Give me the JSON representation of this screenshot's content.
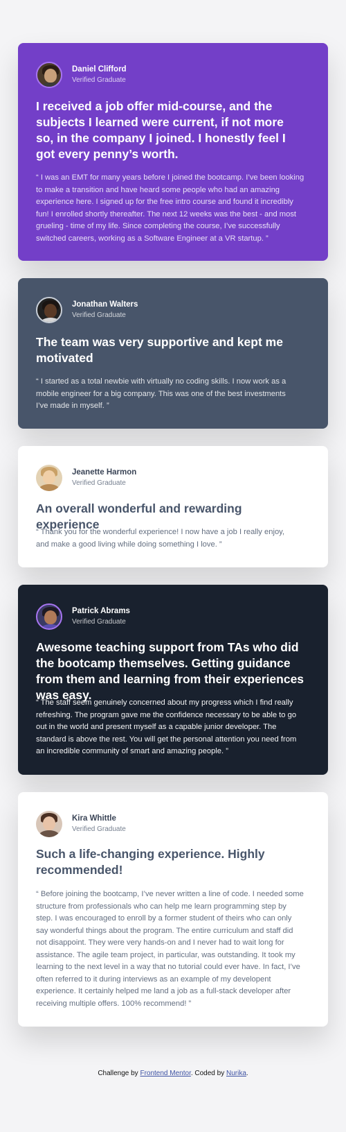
{
  "testimonials": [
    {
      "name": "Daniel Clifford",
      "status": "Verified Graduate",
      "headline": "I received a job offer mid-course, and the subjects I learned were current, if not more so, in the company I joined. I honestly feel I got every penny’s worth.",
      "quote": "“ I was an EMT for many years before I joined the bootcamp. I’ve been looking to make a transition and have heard some people who had an amazing experience here. I signed up for the free intro course and found it incredibly fun! I enrolled shortly thereafter. The next 12 weeks was the best - and most grueling - time of my life. Since completing the course, I’ve successfully switched careers, working as a Software Engineer at a VR startup. ”"
    },
    {
      "name": "Jonathan Walters",
      "status": "Verified Graduate",
      "headline": "The team was very supportive and kept me motivated",
      "quote": "“ I started as a total newbie with virtually no coding skills. I now work as a mobile engineer for a big company. This was one of the best investments I’ve made in myself. ”"
    },
    {
      "name": "Jeanette Harmon",
      "status": "Verified Graduate",
      "headline": "An overall wonderful and rewarding experience",
      "quote": "“ Thank you for the wonderful experience! I now have a job I really enjoy, and make a good living while doing something I love. ”"
    },
    {
      "name": "Patrick Abrams",
      "status": "Verified Graduate",
      "headline": "Awesome teaching support from TAs who did the bootcamp themselves. Getting guidance from them and learning from their experiences was easy.",
      "quote": "“ The staff seem genuinely concerned about my progress which I find really refreshing. The program gave me the confidence necessary to be able to go out in the world and present myself as a capable junior developer. The standard is above the rest. You will get the personal attention you need from an incredible community of smart and amazing people. ”"
    },
    {
      "name": "Kira Whittle",
      "status": "Verified Graduate",
      "headline": "Such a life-changing experience. Highly recommended!",
      "quote": "“ Before joining the bootcamp, I’ve never written a line of code. I needed some structure from professionals who can help me learn programming step by step. I was encouraged to enroll by a former student of theirs who can only say wonderful things about the program. The entire curriculum and staff did not disappoint. They were very hands-on and I never had to wait long for assistance. The agile team project, in particular, was outstanding. It took my learning to the next level in a way that no tutorial could ever have. In fact, I’ve often referred to it during interviews as an example of my developent experience. It certainly helped me land a job as a full-stack developer after receiving multiple offers. 100% recommend! ”"
    }
  ],
  "attribution": {
    "prefix": "Challenge by ",
    "link1": "Frontend Mentor",
    "middle": ". Coded by ",
    "link2": "Nurika",
    "suffix": "."
  },
  "colors": {
    "purple": "#733fc8",
    "slate": "#48556a",
    "dark": "#19212e",
    "white": "#ffffff",
    "background": "#f4f4f6",
    "accent_border": "#a775f1"
  }
}
